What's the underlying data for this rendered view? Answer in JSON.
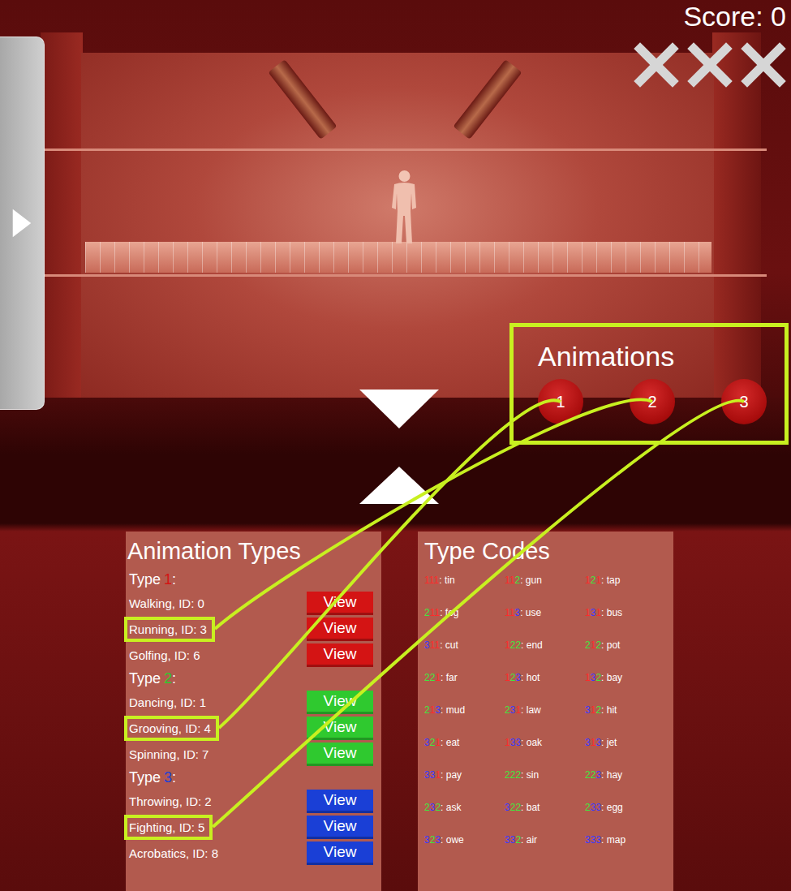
{
  "hud": {
    "score": "Score: 0",
    "lives": [
      {
        "lost": false
      },
      {
        "lost": false
      },
      {
        "lost": false
      }
    ]
  },
  "side_panel": {
    "expanded": false
  },
  "animations": {
    "title": "Animations",
    "buttons": [
      {
        "label": "1"
      },
      {
        "label": "2"
      },
      {
        "label": "3"
      }
    ]
  },
  "animation_types": {
    "title": "Animation Types",
    "groups": [
      {
        "prefix": "Type",
        "number": "1",
        "suffix": ":",
        "color": "#d41414",
        "items": [
          {
            "name": "Walking, ID: 0",
            "button": "View",
            "highlighted": false,
            "linked_button": null
          },
          {
            "name": "Running, ID: 3",
            "button": "View",
            "highlighted": true,
            "linked_button": 1
          },
          {
            "name": "Golfing, ID: 6",
            "button": "View",
            "highlighted": false,
            "linked_button": null
          }
        ]
      },
      {
        "prefix": "Type",
        "number": "2",
        "suffix": ":",
        "color": "#2fc92f",
        "items": [
          {
            "name": "Dancing, ID: 1",
            "button": "View",
            "highlighted": false,
            "linked_button": null
          },
          {
            "name": "Grooving, ID: 4",
            "button": "View",
            "highlighted": true,
            "linked_button": 0
          },
          {
            "name": "Spinning, ID: 7",
            "button": "View",
            "highlighted": false,
            "linked_button": null
          }
        ]
      },
      {
        "prefix": "Type",
        "number": "3",
        "suffix": ":",
        "color": "#1a3fd6",
        "items": [
          {
            "name": "Throwing, ID: 2",
            "button": "View",
            "highlighted": false,
            "linked_button": null
          },
          {
            "name": "Fighting, ID: 5",
            "button": "View",
            "highlighted": true,
            "linked_button": 2
          },
          {
            "name": "Acrobatics, ID: 8",
            "button": "View",
            "highlighted": false,
            "linked_button": null
          }
        ]
      }
    ]
  },
  "type_codes": {
    "title": "Type Codes",
    "digit_colors": {
      "1": "#ff2a2a",
      "2": "#3ee83e",
      "3": "#3a3aff"
    },
    "codes": [
      {
        "code": "111",
        "text": ": tin"
      },
      {
        "code": "112",
        "text": ": gun"
      },
      {
        "code": "121",
        "text": ": tap"
      },
      {
        "code": "211",
        "text": ": fog"
      },
      {
        "code": "113",
        "text": ": use"
      },
      {
        "code": "131",
        "text": ": bus"
      },
      {
        "code": "311",
        "text": ": cut"
      },
      {
        "code": "122",
        "text": ": end"
      },
      {
        "code": "212",
        "text": ": pot"
      },
      {
        "code": "221",
        "text": ": far"
      },
      {
        "code": "123",
        "text": ": hot"
      },
      {
        "code": "132",
        "text": ": bay"
      },
      {
        "code": "213",
        "text": ": mud"
      },
      {
        "code": "231",
        "text": ": law"
      },
      {
        "code": "312",
        "text": ": hit"
      },
      {
        "code": "321",
        "text": ": eat"
      },
      {
        "code": "133",
        "text": ": oak"
      },
      {
        "code": "313",
        "text": ": jet"
      },
      {
        "code": "331",
        "text": ": pay"
      },
      {
        "code": "222",
        "text": ": sin"
      },
      {
        "code": "223",
        "text": ": hay"
      },
      {
        "code": "232",
        "text": ": ask"
      },
      {
        "code": "322",
        "text": ": bat"
      },
      {
        "code": "233",
        "text": ": egg"
      },
      {
        "code": "323",
        "text": ": owe"
      },
      {
        "code": "332",
        "text": ": air"
      },
      {
        "code": "333",
        "text": ": map"
      }
    ]
  }
}
